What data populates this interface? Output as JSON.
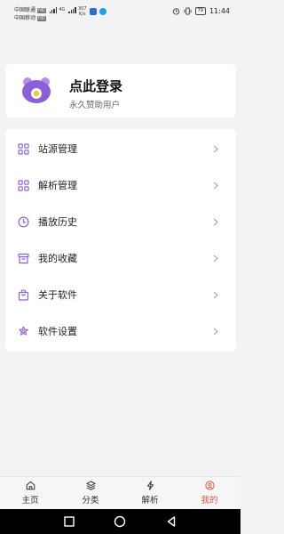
{
  "status_bar": {
    "carrier1": "中国联通",
    "carrier1_tag": "HD",
    "carrier2": "中国移动",
    "carrier2_tag": "HD",
    "net_type": "4G",
    "speed_value": "307",
    "speed_unit": "K/s",
    "battery": "79",
    "time": "11:44"
  },
  "profile": {
    "title": "点此登录",
    "subtitle": "永久赞助用户"
  },
  "menu": {
    "items": [
      {
        "label": "站源管理",
        "icon": "grid-icon"
      },
      {
        "label": "解析管理",
        "icon": "grid-icon"
      },
      {
        "label": "播放历史",
        "icon": "clock-icon"
      },
      {
        "label": "我的收藏",
        "icon": "archive-icon"
      },
      {
        "label": "关于软件",
        "icon": "bag-icon"
      },
      {
        "label": "软件设置",
        "icon": "flower-icon"
      }
    ]
  },
  "bottom_nav": {
    "items": [
      {
        "label": "主页",
        "icon": "home-icon"
      },
      {
        "label": "分类",
        "icon": "layers-icon"
      },
      {
        "label": "解析",
        "icon": "bolt-icon"
      },
      {
        "label": "我的",
        "icon": "user-icon",
        "active": true
      }
    ]
  },
  "colors": {
    "accent_purple": "#8a60d8",
    "active_tab": "#e0553c",
    "background": "#f3f3f5"
  }
}
